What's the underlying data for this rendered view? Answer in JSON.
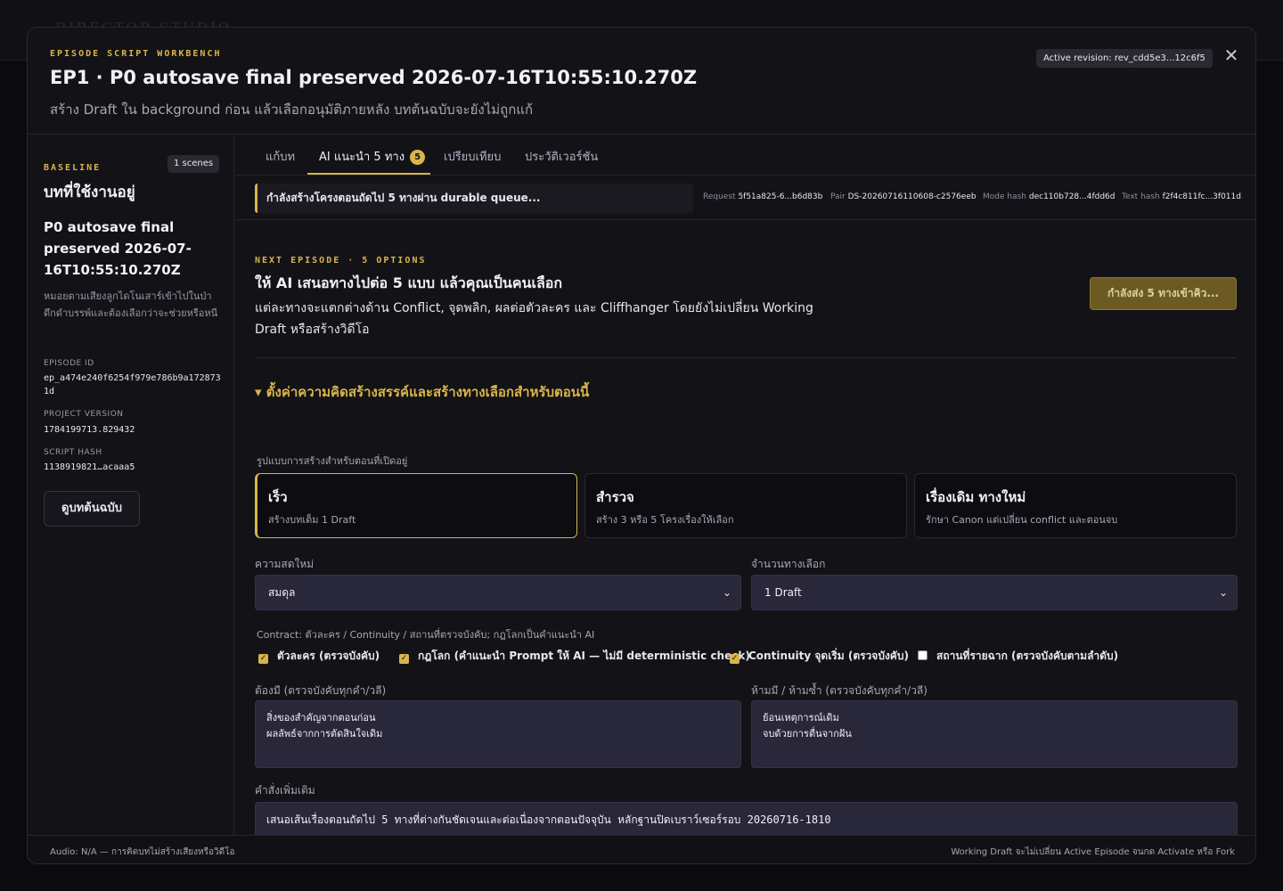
{
  "background": {
    "app_title": "DIRECTOR STUDIO"
  },
  "header": {
    "kicker": "EPISODE SCRIPT WORKBENCH",
    "title": "EP1 · P0 autosave final preserved 2026-07-16T10:55:10.270Z",
    "subtitle": "สร้าง Draft ใน background ก่อน แล้วเลือกอนุมัติภายหลัง บทต้นฉบับจะยังไม่ถูกแก้",
    "revision_badge": "Active revision: rev_cdd5e3...12c6f5",
    "close_label": "✕"
  },
  "sidebar": {
    "kicker": "BASELINE",
    "scenes_badge": "1 scenes",
    "heading": "บทที่ใช้งานอยู่",
    "episode_name": "P0 autosave final preserved 2026-07-16T10:55:10.270Z",
    "note": "หมอยตามเสียงลูกไดโนเสาร์เข้าไปในป่าดึกดำบรรพ์และต้องเลือกว่าจะช่วยหรือหนี",
    "episode_id_label": "EPISODE ID",
    "episode_id": "ep_a474e240f6254f979e786b9a1728731d",
    "project_version_label": "PROJECT VERSION",
    "project_version": "1784199713.829432",
    "script_hash_label": "SCRIPT HASH",
    "script_hash": "1138919821…acaaa5",
    "view_original_button": "ดูบทต้นฉบับ"
  },
  "tabs": [
    {
      "label": "แก้บท"
    },
    {
      "label": "AI แนะนำ 5 ทาง",
      "count": "5"
    },
    {
      "label": "เปรียบเทียบ"
    },
    {
      "label": "ประวัติเวอร์ชัน"
    }
  ],
  "status": {
    "queue_message": "กำลังสร้างโครงตอนถัดไป 5 ทางผ่าน durable queue...",
    "request_label": "Request",
    "request_value": "5f51a825-6...b6d83b",
    "pair_label": "Pair",
    "pair_value": "DS-20260716110608-c2576eeb",
    "mode_hash_label": "Mode hash",
    "mode_hash_value": "dec110b728...4fdd6d",
    "text_hash_label": "Text hash",
    "text_hash_value": "f2f4c811fc...3f011d"
  },
  "next": {
    "kicker": "NEXT EPISODE · 5 OPTIONS",
    "heading": "ให้ AI เสนอทางไปต่อ 5 แบบ แล้วคุณเป็นคนเลือก",
    "description": "แต่ละทางจะแตกต่างด้าน Conflict, จุดพลิก, ผลต่อตัวละคร และ Cliffhanger โดยยังไม่เปลี่ยน Working Draft หรือสร้างวิดีโอ",
    "generate_button": "กำลังส่ง 5 ทางเข้าคิว..."
  },
  "settings": {
    "summary": "▾ ตั้งค่าความคิดสร้างสรรค์และสร้างทางเลือกสำหรับตอนนี้",
    "mode_label": "รูปแบบการสร้างสำหรับตอนที่เปิดอยู่",
    "modes": [
      {
        "title": "เร็ว",
        "desc": "สร้างบทเต็ม 1 Draft"
      },
      {
        "title": "สำรวจ",
        "desc": "สร้าง 3 หรือ 5 โครงเรื่องให้เลือก"
      },
      {
        "title": "เรื่องเดิม ทางใหม่",
        "desc": "รักษา Canon แต่เปลี่ยน conflict และตอนจบ"
      }
    ],
    "freshness_label": "ความสดใหม่",
    "freshness_value": "สมดุล",
    "count_label": "จำนวนทางเลือก",
    "count_value": "1 Draft",
    "contract_label": "Contract: ตัวละคร / Continuity / สถานที่ตรวจบังคับ; กฎโลกเป็นคำแนะนำ AI",
    "checks": [
      {
        "label": "ตัวละคร (ตรวจบังคับ)",
        "checked": true
      },
      {
        "label": "กฎโลก (คำแนะนำ Prompt ให้ AI — ไม่มี deterministic check)",
        "checked": true
      },
      {
        "label": "Continuity จุดเริ่ม (ตรวจบังคับ)",
        "checked": true
      },
      {
        "label": "สถานที่รายฉาก (ตรวจบังคับตามลำดับ)",
        "checked": false
      }
    ],
    "must_have_label": "ต้องมี (ตรวจบังคับทุกคำ/วลี)",
    "must_have_value": "สิ่งของสำคัญจากตอนก่อน\nผลลัพธ์จากการตัดสินใจเดิม",
    "forbidden_label": "ห้ามมี / ห้ามซ้ำ (ตรวจบังคับทุกคำ/วลี)",
    "forbidden_value": "ย้อนเหตุการณ์เดิม\nจบด้วยการตื่นจากฝัน",
    "extra_label": "คำสั่งเพิ่มเติม",
    "extra_value": "เสนอเส้นเรื่องตอนถัดไป 5 ทางที่ต่างกันชัดเจนและต่อเนื่องจากตอนปัจจุบัน หลักฐานปิดเบราว์เซอร์รอบ 20260716-1810"
  },
  "footer": {
    "left": "Audio: N/A — การคิดบทไม่สร้างเสียงหรือวิดีโอ",
    "right": "Working Draft จะไม่เปลี่ยน Active Episode จนกด Activate หรือ Fork"
  },
  "colors": {
    "accent": "#d8b54a",
    "panel": "#131217",
    "input": "#29273a"
  }
}
